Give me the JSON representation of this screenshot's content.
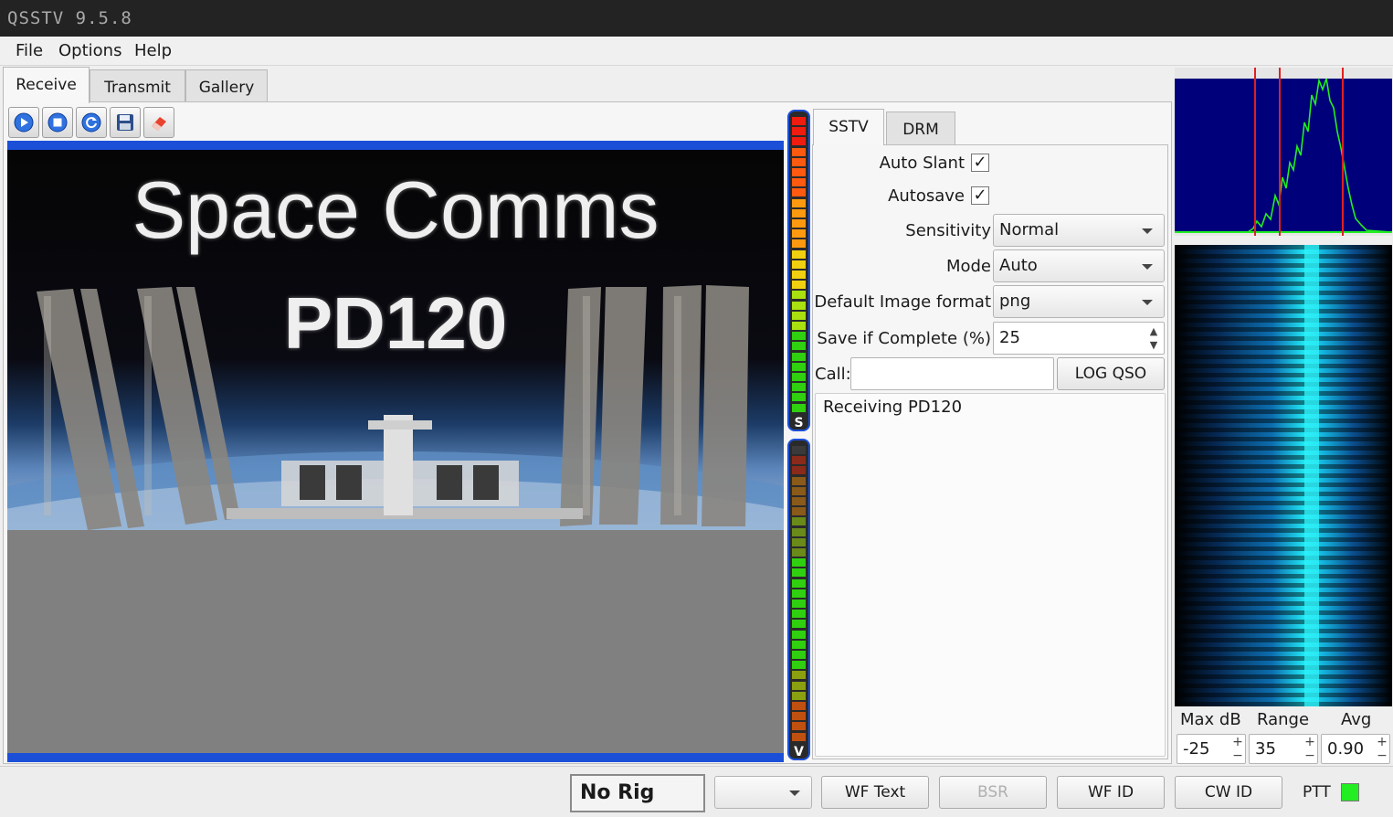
{
  "window": {
    "title": "QSSTV 9.5.8"
  },
  "menu": {
    "file": "File",
    "options": "Options",
    "help": "Help"
  },
  "main_tabs": {
    "receive": "Receive",
    "transmit": "Transmit",
    "gallery": "Gallery"
  },
  "image": {
    "line1": "Space Comms",
    "line2": "PD120",
    "progress_fraction": 0.63
  },
  "mode_tabs": {
    "sstv": "SSTV",
    "drm": "DRM"
  },
  "settings": {
    "auto_slant_label": "Auto Slant",
    "auto_slant_checked": "✓",
    "autosave_label": "Autosave",
    "autosave_checked": "✓",
    "sensitivity_label": "Sensitivity",
    "sensitivity_value": "Normal",
    "mode_label": "Mode",
    "mode_value": "Auto",
    "image_format_label": "Default Image format",
    "image_format_value": "png",
    "save_complete_label": "Save if Complete (%)",
    "save_complete_value": "25",
    "call_label": "Call:",
    "call_value": "",
    "log_qso_label": "LOG QSO",
    "status_text": "Receiving PD120"
  },
  "meters": {
    "top_marker": "S",
    "bottom_marker": "V"
  },
  "spectrum": {
    "max_db_label": "Max dB",
    "range_label": "Range",
    "avg_label": "Avg",
    "max_db_value": "-25",
    "range_value": "35",
    "avg_value": "0.90",
    "plus": "+",
    "minus": "−"
  },
  "statusbar": {
    "rig": "No Rig",
    "combo_value": "",
    "wf_text": "WF Text",
    "bsr": "BSR",
    "wf_id": "WF ID",
    "cw_id": "CW ID",
    "ptt": "PTT"
  },
  "colors": {
    "accent": "#1b4fd8",
    "spectrum_bg": "#00007a",
    "ptt_on": "#22ee22",
    "waterfall": "#12d8e6"
  }
}
